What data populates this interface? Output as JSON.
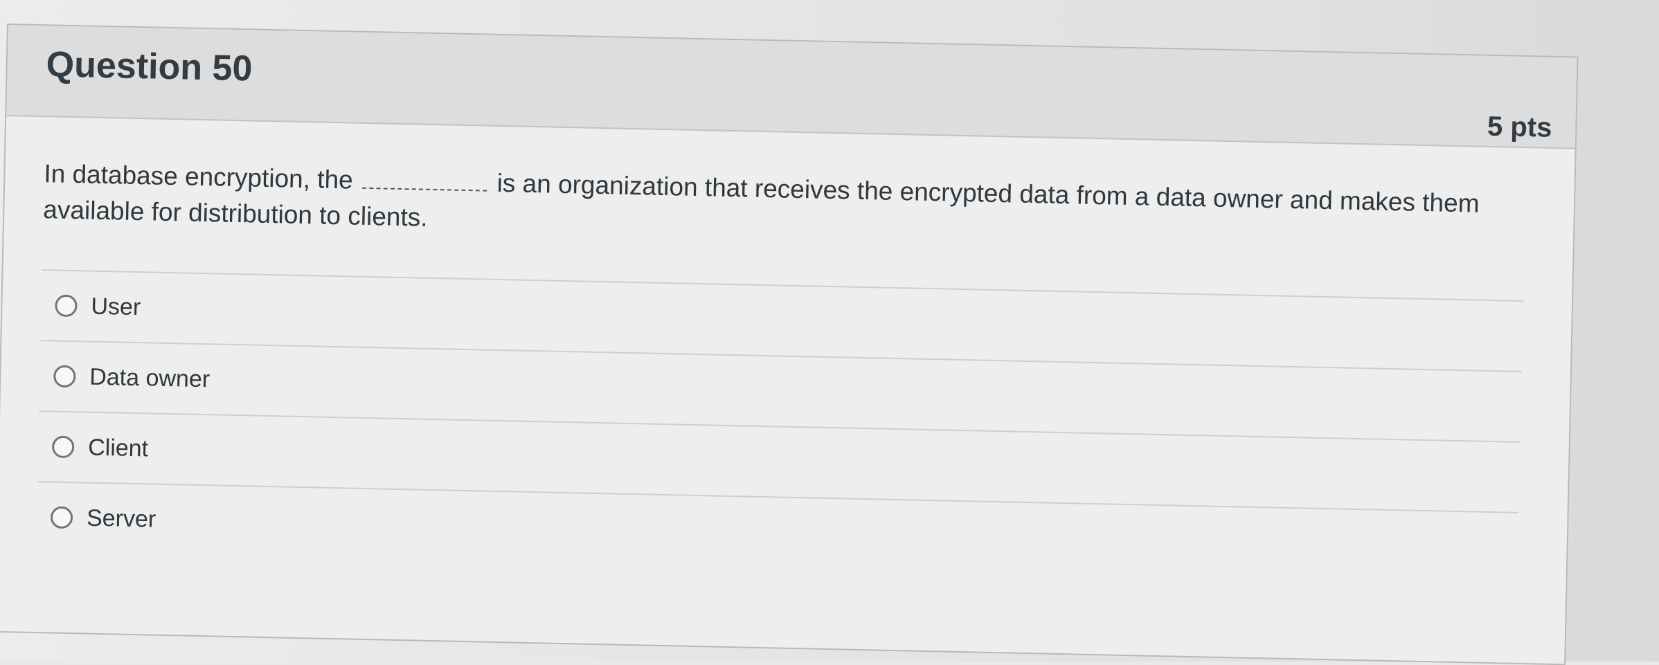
{
  "question": {
    "title": "Question 50",
    "points": "5 pts",
    "text_before": "In database encryption, the",
    "text_after": "is an organization that receives the encrypted data from a data owner and makes them available for  distribution to clients."
  },
  "answers": [
    {
      "label": "User"
    },
    {
      "label": "Data owner"
    },
    {
      "label": "Client"
    },
    {
      "label": "Server"
    }
  ],
  "icons": {
    "radio": "radio-unselected-icon"
  }
}
